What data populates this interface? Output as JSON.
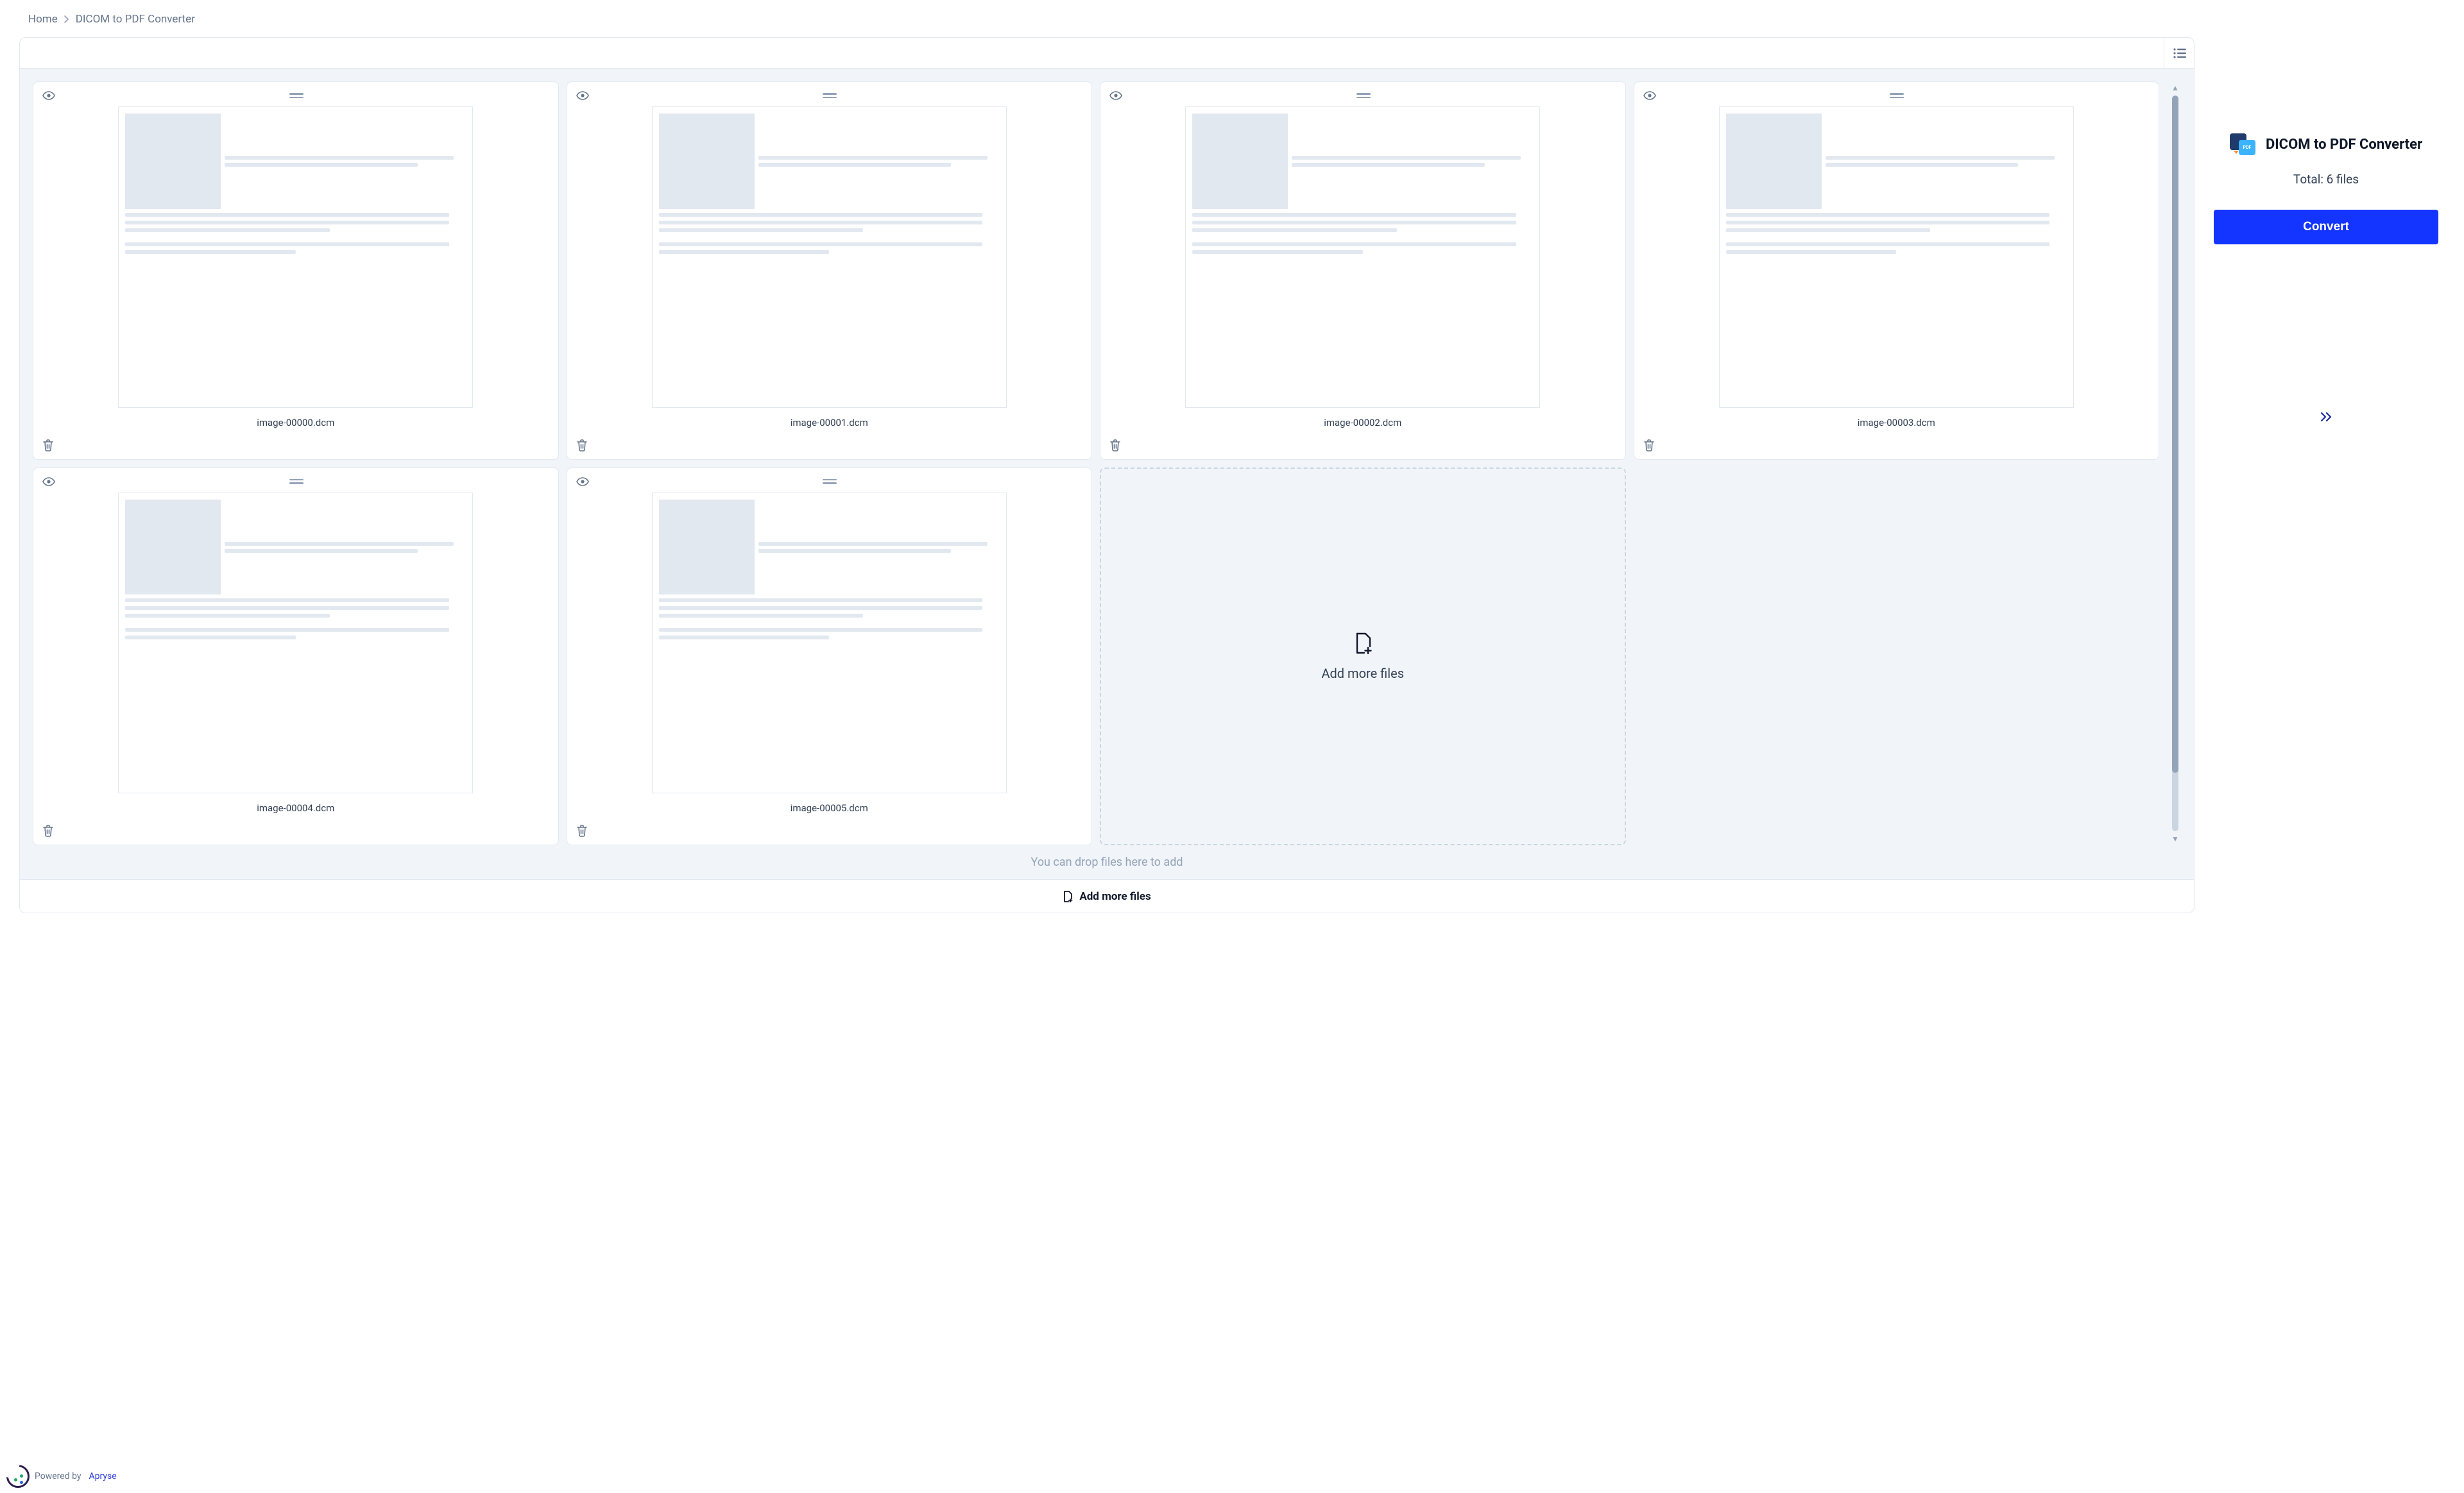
{
  "breadcrumb": {
    "home": "Home",
    "current": "DICOM to PDF Converter"
  },
  "files": [
    {
      "name": "image-00000.dcm"
    },
    {
      "name": "image-00001.dcm"
    },
    {
      "name": "image-00002.dcm"
    },
    {
      "name": "image-00003.dcm"
    },
    {
      "name": "image-00004.dcm"
    },
    {
      "name": "image-00005.dcm"
    }
  ],
  "add_card_label": "Add more files",
  "drop_hint": "You can drop files here to add",
  "footer_add_label": "Add more files",
  "side": {
    "title": "DICOM to PDF Converter",
    "total_label": "Total: 6 files",
    "convert_label": "Convert"
  },
  "powered": {
    "prefix": "Powered by",
    "brand": "Apryse"
  },
  "icons": {
    "list_view": "list-icon",
    "eye": "eye-icon",
    "drag": "drag-handle-icon",
    "trash": "trash-icon",
    "file_plus": "file-plus-icon",
    "chevrons": "chevrons-right-icon"
  }
}
